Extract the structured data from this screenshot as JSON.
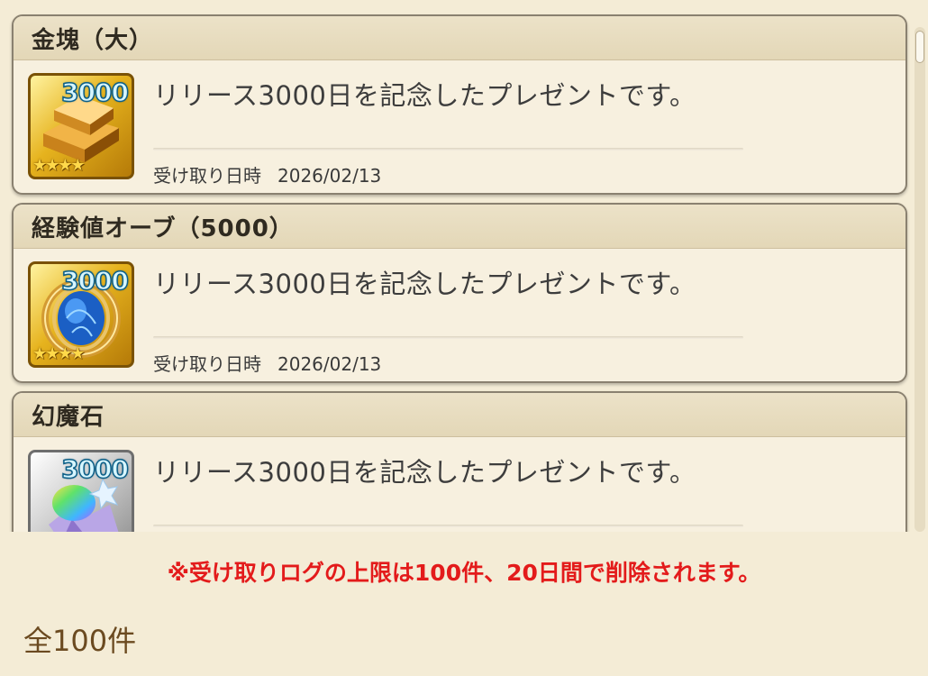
{
  "colors": {
    "notice": "#e31b1b",
    "total": "#6b4a20",
    "background": "#f4ecd6"
  },
  "presents": [
    {
      "title": "金塊（大）",
      "quantity": "3000",
      "stars": "★★★★",
      "icon": "gold-bars-icon",
      "description": "リリース3000日を記念したプレゼントです。",
      "received_label": "受け取り日時",
      "received_date": "2026/02/13"
    },
    {
      "title": "経験値オーブ（5000）",
      "quantity": "3000",
      "stars": "★★★★",
      "icon": "experience-orb-icon",
      "description": "リリース3000日を記念したプレゼントです。",
      "received_label": "受け取り日時",
      "received_date": "2026/02/13"
    },
    {
      "title": "幻魔石",
      "quantity": "3000",
      "icon": "genma-stone-icon",
      "description": "リリース3000日を記念したプレゼントです。"
    }
  ],
  "footer": {
    "notice": "※受け取りログの上限は100件、20日間で削除されます。",
    "total": "全100件"
  }
}
